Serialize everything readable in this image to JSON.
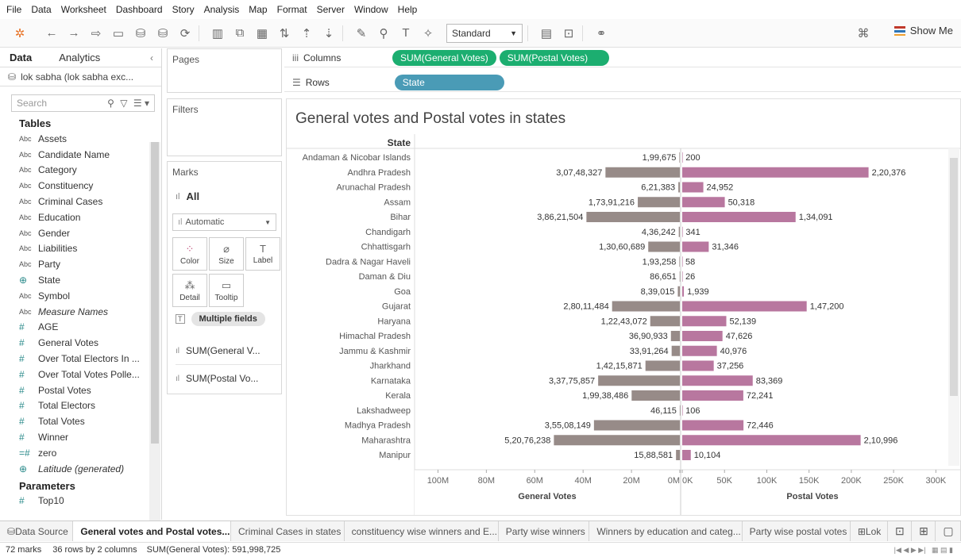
{
  "menu": [
    "File",
    "Data",
    "Worksheet",
    "Dashboard",
    "Story",
    "Analysis",
    "Map",
    "Format",
    "Server",
    "Window",
    "Help"
  ],
  "toolbar": {
    "fit_select": "Standard",
    "show_me": "Show Me"
  },
  "data_pane": {
    "tabs": [
      "Data",
      "Analytics"
    ],
    "datasource": "lok sabha (lok sabha exc...",
    "search_placeholder": "Search",
    "tables_heading": "Tables",
    "fields": [
      {
        "type": "Abc",
        "name": "Assets"
      },
      {
        "type": "Abc",
        "name": "Candidate Name"
      },
      {
        "type": "Abc",
        "name": "Category"
      },
      {
        "type": "Abc",
        "name": "Constituency"
      },
      {
        "type": "Abc",
        "name": "Criminal Cases"
      },
      {
        "type": "Abc",
        "name": "Education"
      },
      {
        "type": "Abc",
        "name": "Gender"
      },
      {
        "type": "Abc",
        "name": "Liabilities"
      },
      {
        "type": "Abc",
        "name": "Party"
      },
      {
        "type": "geo",
        "name": "State"
      },
      {
        "type": "Abc",
        "name": "Symbol"
      },
      {
        "type": "Abc",
        "name": "Measure Names",
        "italic": true
      },
      {
        "type": "#",
        "name": "AGE"
      },
      {
        "type": "#",
        "name": "General Votes"
      },
      {
        "type": "#",
        "name": "Over Total Electors In ..."
      },
      {
        "type": "#",
        "name": "Over Total Votes Polle..."
      },
      {
        "type": "#",
        "name": "Postal Votes"
      },
      {
        "type": "#",
        "name": "Total Electors"
      },
      {
        "type": "#",
        "name": "Total Votes"
      },
      {
        "type": "#",
        "name": "Winner"
      },
      {
        "type": "=#",
        "name": "zero"
      },
      {
        "type": "geo",
        "name": "Latitude (generated)",
        "italic": true
      }
    ],
    "parameters_heading": "Parameters",
    "parameters": [
      {
        "type": "#",
        "name": "Top10"
      }
    ]
  },
  "shelves": {
    "pages": "Pages",
    "filters": "Filters",
    "marks": "Marks",
    "marks_all": "All",
    "mark_type": "Automatic",
    "mark_buttons": [
      "Color",
      "Size",
      "Label",
      "Detail",
      "Tooltip"
    ],
    "multiple_fields": "Multiple fields",
    "measure_cards": [
      "SUM(General V...",
      "SUM(Postal Vo..."
    ],
    "columns_label": "Columns",
    "rows_label": "Rows",
    "columns_pills": [
      "SUM(General Votes)",
      "SUM(Postal Votes)"
    ],
    "rows_pills": [
      "State"
    ]
  },
  "view": {
    "title": "General votes and Postal votes in states",
    "state_header": "State"
  },
  "chart_data": {
    "type": "bar",
    "title": "General votes and Postal votes in states",
    "categories": [
      "Andaman & Nicobar Islands",
      "Andhra Pradesh",
      "Arunachal Pradesh",
      "Assam",
      "Bihar",
      "Chandigarh",
      "Chhattisgarh",
      "Dadra & Nagar Haveli",
      "Daman & Diu",
      "Goa",
      "Gujarat",
      "Haryana",
      "Himachal Pradesh",
      "Jammu & Kashmir",
      "Jharkhand",
      "Karnataka",
      "Kerala",
      "Lakshadweep",
      "Madhya Pradesh",
      "Maharashtra",
      "Manipur"
    ],
    "series": [
      {
        "name": "General Votes",
        "color": "#978b88",
        "axis": "reversed",
        "xlim": [
          0,
          110000000
        ],
        "ticks": [
          "100M",
          "80M",
          "60M",
          "40M",
          "20M",
          "0M"
        ],
        "values": [
          199675,
          30748327,
          621383,
          17391216,
          38621504,
          436242,
          13060689,
          193258,
          86651,
          839015,
          28011484,
          12243072,
          3690933,
          3391264,
          14215871,
          33775857,
          19938486,
          46115,
          35508149,
          52076238,
          1588581
        ],
        "labels": [
          "1,99,675",
          "3,07,48,327",
          "6,21,383",
          "1,73,91,216",
          "3,86,21,504",
          "4,36,242",
          "1,30,60,689",
          "1,93,258",
          "86,651",
          "8,39,015",
          "2,80,11,484",
          "1,22,43,072",
          "36,90,933",
          "33,91,264",
          "1,42,15,871",
          "3,37,75,857",
          "1,99,38,486",
          "46,115",
          "3,55,08,149",
          "5,20,76,238",
          "15,88,581"
        ]
      },
      {
        "name": "Postal Votes",
        "color": "#b8779f",
        "xlim": [
          0,
          310000
        ],
        "ticks": [
          "0K",
          "50K",
          "100K",
          "150K",
          "200K",
          "250K",
          "300K"
        ],
        "values": [
          200,
          220376,
          24952,
          50318,
          134091,
          341,
          31346,
          58,
          26,
          1939,
          147200,
          52139,
          47626,
          40976,
          37256,
          83369,
          72241,
          106,
          72446,
          210996,
          10104
        ],
        "labels": [
          "200",
          "2,20,376",
          "24,952",
          "50,318",
          "1,34,091",
          "341",
          "31,346",
          "58",
          "26",
          "1,939",
          "1,47,200",
          "52,139",
          "47,626",
          "40,976",
          "37,256",
          "83,369",
          "72,241",
          "106",
          "72,446",
          "2,10,996",
          "10,104"
        ]
      }
    ],
    "xlabel_left": "General Votes",
    "xlabel_right": "Postal Votes"
  },
  "sheet_tabs": [
    "Data Source",
    "General votes and Postal votes...",
    "Criminal Cases in states",
    "constituency wise winners and E...",
    "Party wise winners",
    "Winners by education and categ...",
    "Party wise postal votes",
    "Lok"
  ],
  "status": {
    "marks": "72 marks",
    "rows_cols": "36 rows by 2 columns",
    "sum": "SUM(General Votes): 591,998,725"
  }
}
